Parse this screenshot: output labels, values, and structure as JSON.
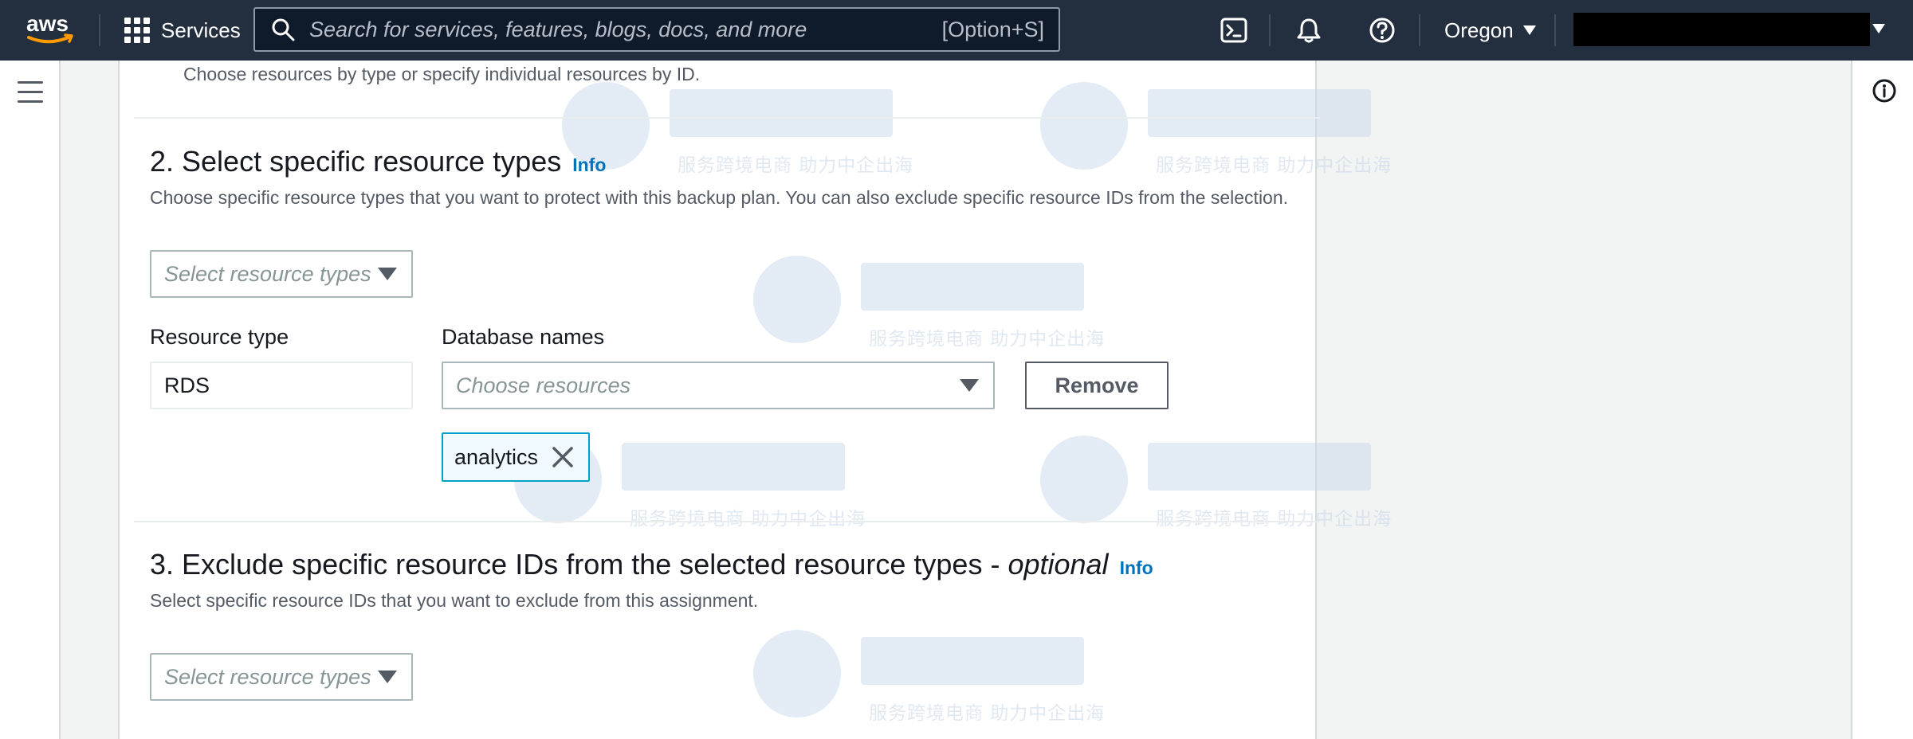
{
  "topnav": {
    "services_label": "Services",
    "search_placeholder": "Search for services, features, blogs, docs, and more",
    "search_shortcut": "[Option+S]",
    "region": "Oregon"
  },
  "section1": {
    "description": "Choose resources by type or specify individual resources by ID."
  },
  "section2": {
    "heading": "2. Select specific resource types",
    "info": "Info",
    "description": "Choose specific resource types that you want to protect with this backup plan. You can also exclude specific resource IDs from the selection.",
    "select_placeholder": "Select resource types",
    "resource_type_label": "Resource type",
    "resource_type_value": "RDS",
    "database_names_label": "Database names",
    "database_select_placeholder": "Choose resources",
    "remove_label": "Remove",
    "tokens": [
      "analytics"
    ]
  },
  "section3": {
    "heading_main": "3. Exclude specific resource IDs from the selected resource types - ",
    "heading_optional": "optional",
    "info": "Info",
    "description": "Select specific resource IDs that you want to exclude from this assignment.",
    "select_placeholder": "Select resource types"
  },
  "watermark": {
    "subtitle": "服务跨境电商 助力中企出海"
  },
  "colors": {
    "nav_bg": "#232f3e",
    "info_link": "#0073bb",
    "token_border": "#00a1c9"
  }
}
